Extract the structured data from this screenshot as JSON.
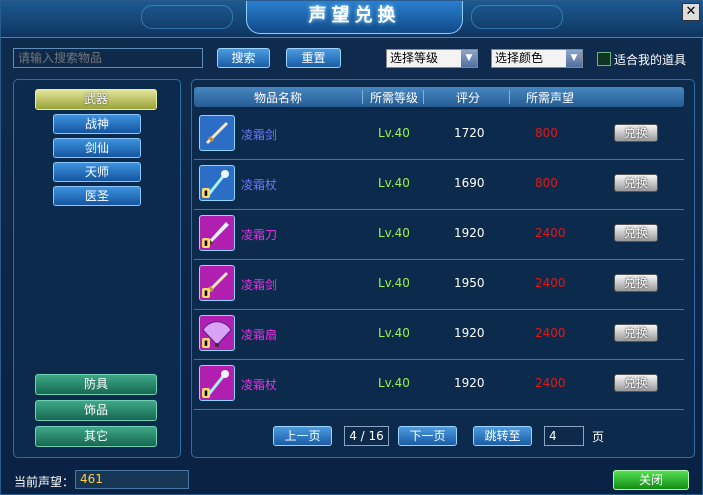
{
  "window": {
    "title": "声望兑换",
    "close_glyph": "✕"
  },
  "search": {
    "placeholder": "请输入搜索物品",
    "search_label": "搜索",
    "reset_label": "重置"
  },
  "filters": {
    "level_select": "选择等级",
    "color_select": "选择颜色",
    "my_items_label": "适合我的道具",
    "my_items_checked": false
  },
  "categories": {
    "active": "武器",
    "subitems": [
      "战神",
      "剑仙",
      "天师",
      "医圣"
    ],
    "others": [
      "防具",
      "饰品",
      "其它"
    ]
  },
  "table": {
    "headers": [
      "物品名称",
      "所需等级",
      "评分",
      "所需声望"
    ],
    "redeem_label": "兑换",
    "rows": [
      {
        "name": "凌霜剑",
        "level": "Lv.40",
        "score": "1720",
        "reputation": "800",
        "icon": "sword-icon",
        "name_color": "#6a78ff",
        "bg": "#2c6ec6",
        "locked": false
      },
      {
        "name": "凌霜杖",
        "level": "Lv.40",
        "score": "1690",
        "reputation": "800",
        "icon": "staff-icon",
        "name_color": "#6a78ff",
        "bg": "#2c6ec6",
        "locked": true
      },
      {
        "name": "凌霜刀",
        "level": "Lv.40",
        "score": "1920",
        "reputation": "2400",
        "icon": "blade-icon",
        "name_color": "#ee2ee8",
        "bg": "#b01fb0",
        "locked": true
      },
      {
        "name": "凌霜剑",
        "level": "Lv.40",
        "score": "1950",
        "reputation": "2400",
        "icon": "sword-icon",
        "name_color": "#ee2ee8",
        "bg": "#b01fb0",
        "locked": true
      },
      {
        "name": "凌霜扇",
        "level": "Lv.40",
        "score": "1920",
        "reputation": "2400",
        "icon": "fan-icon",
        "name_color": "#ee2ee8",
        "bg": "#b01fb0",
        "locked": true
      },
      {
        "name": "凌霜杖",
        "level": "Lv.40",
        "score": "1920",
        "reputation": "2400",
        "icon": "staff-icon",
        "name_color": "#ee2ee8",
        "bg": "#b01fb0",
        "locked": true
      }
    ]
  },
  "pager": {
    "prev_label": "上一页",
    "page_display": "4 / 16",
    "next_label": "下一页",
    "jump_label": "跳转至",
    "jump_value": "4",
    "page_unit": "页"
  },
  "footer": {
    "reputation_label": "当前声望：",
    "reputation_value": "461",
    "close_label": "关闭"
  },
  "colors": {
    "level": "#9cf24a",
    "reputation": "#e11818",
    "score": "#ffffff"
  }
}
